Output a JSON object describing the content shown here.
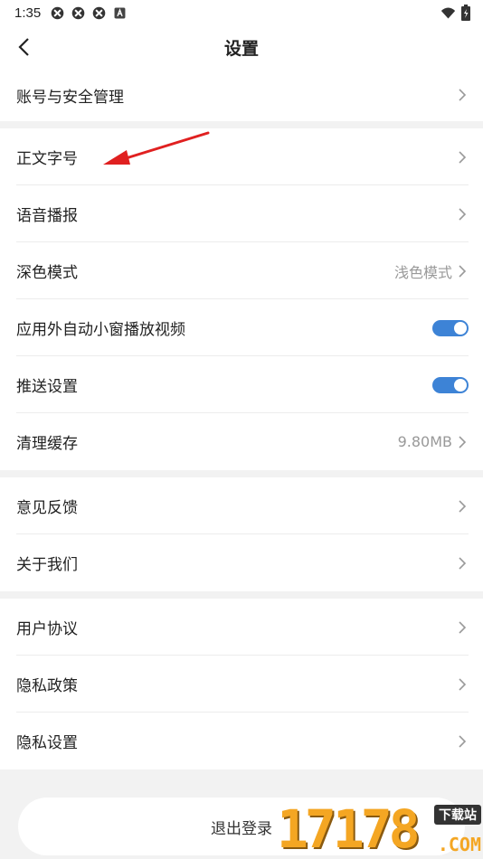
{
  "status_bar": {
    "time": "1:35",
    "left_icons": [
      "app-notification-icon",
      "app-notification-icon",
      "app-notification-icon",
      "android-a-icon"
    ],
    "right_icons": [
      "wifi-icon",
      "battery-charging-icon"
    ]
  },
  "header": {
    "title": "设置"
  },
  "groups": [
    [
      {
        "label": "账号与安全管理",
        "value": "",
        "control": "chevron"
      }
    ],
    [
      {
        "label": "正文字号",
        "value": "",
        "control": "chevron"
      },
      {
        "label": "语音播报",
        "value": "",
        "control": "chevron"
      },
      {
        "label": "深色模式",
        "value": "浅色模式",
        "control": "chevron"
      },
      {
        "label": "应用外自动小窗播放视频",
        "value": "",
        "control": "toggle",
        "on": true
      },
      {
        "label": "推送设置",
        "value": "",
        "control": "toggle",
        "on": true
      },
      {
        "label": "清理缓存",
        "value": "9.80MB",
        "control": "chevron"
      }
    ],
    [
      {
        "label": "意见反馈",
        "value": "",
        "control": "chevron"
      },
      {
        "label": "关于我们",
        "value": "",
        "control": "chevron"
      }
    ],
    [
      {
        "label": "用户协议",
        "value": "",
        "control": "chevron"
      },
      {
        "label": "隐私政策",
        "value": "",
        "control": "chevron"
      },
      {
        "label": "隐私设置",
        "value": "",
        "control": "chevron"
      }
    ]
  ],
  "logout": {
    "label": "退出登录"
  },
  "watermark": {
    "digits": "17178",
    "badge": "下载站",
    "domain": ".COM"
  },
  "colors": {
    "toggle_on": "#3d83d6",
    "annotation_arrow": "#e02020",
    "watermark": "#f4a623"
  }
}
